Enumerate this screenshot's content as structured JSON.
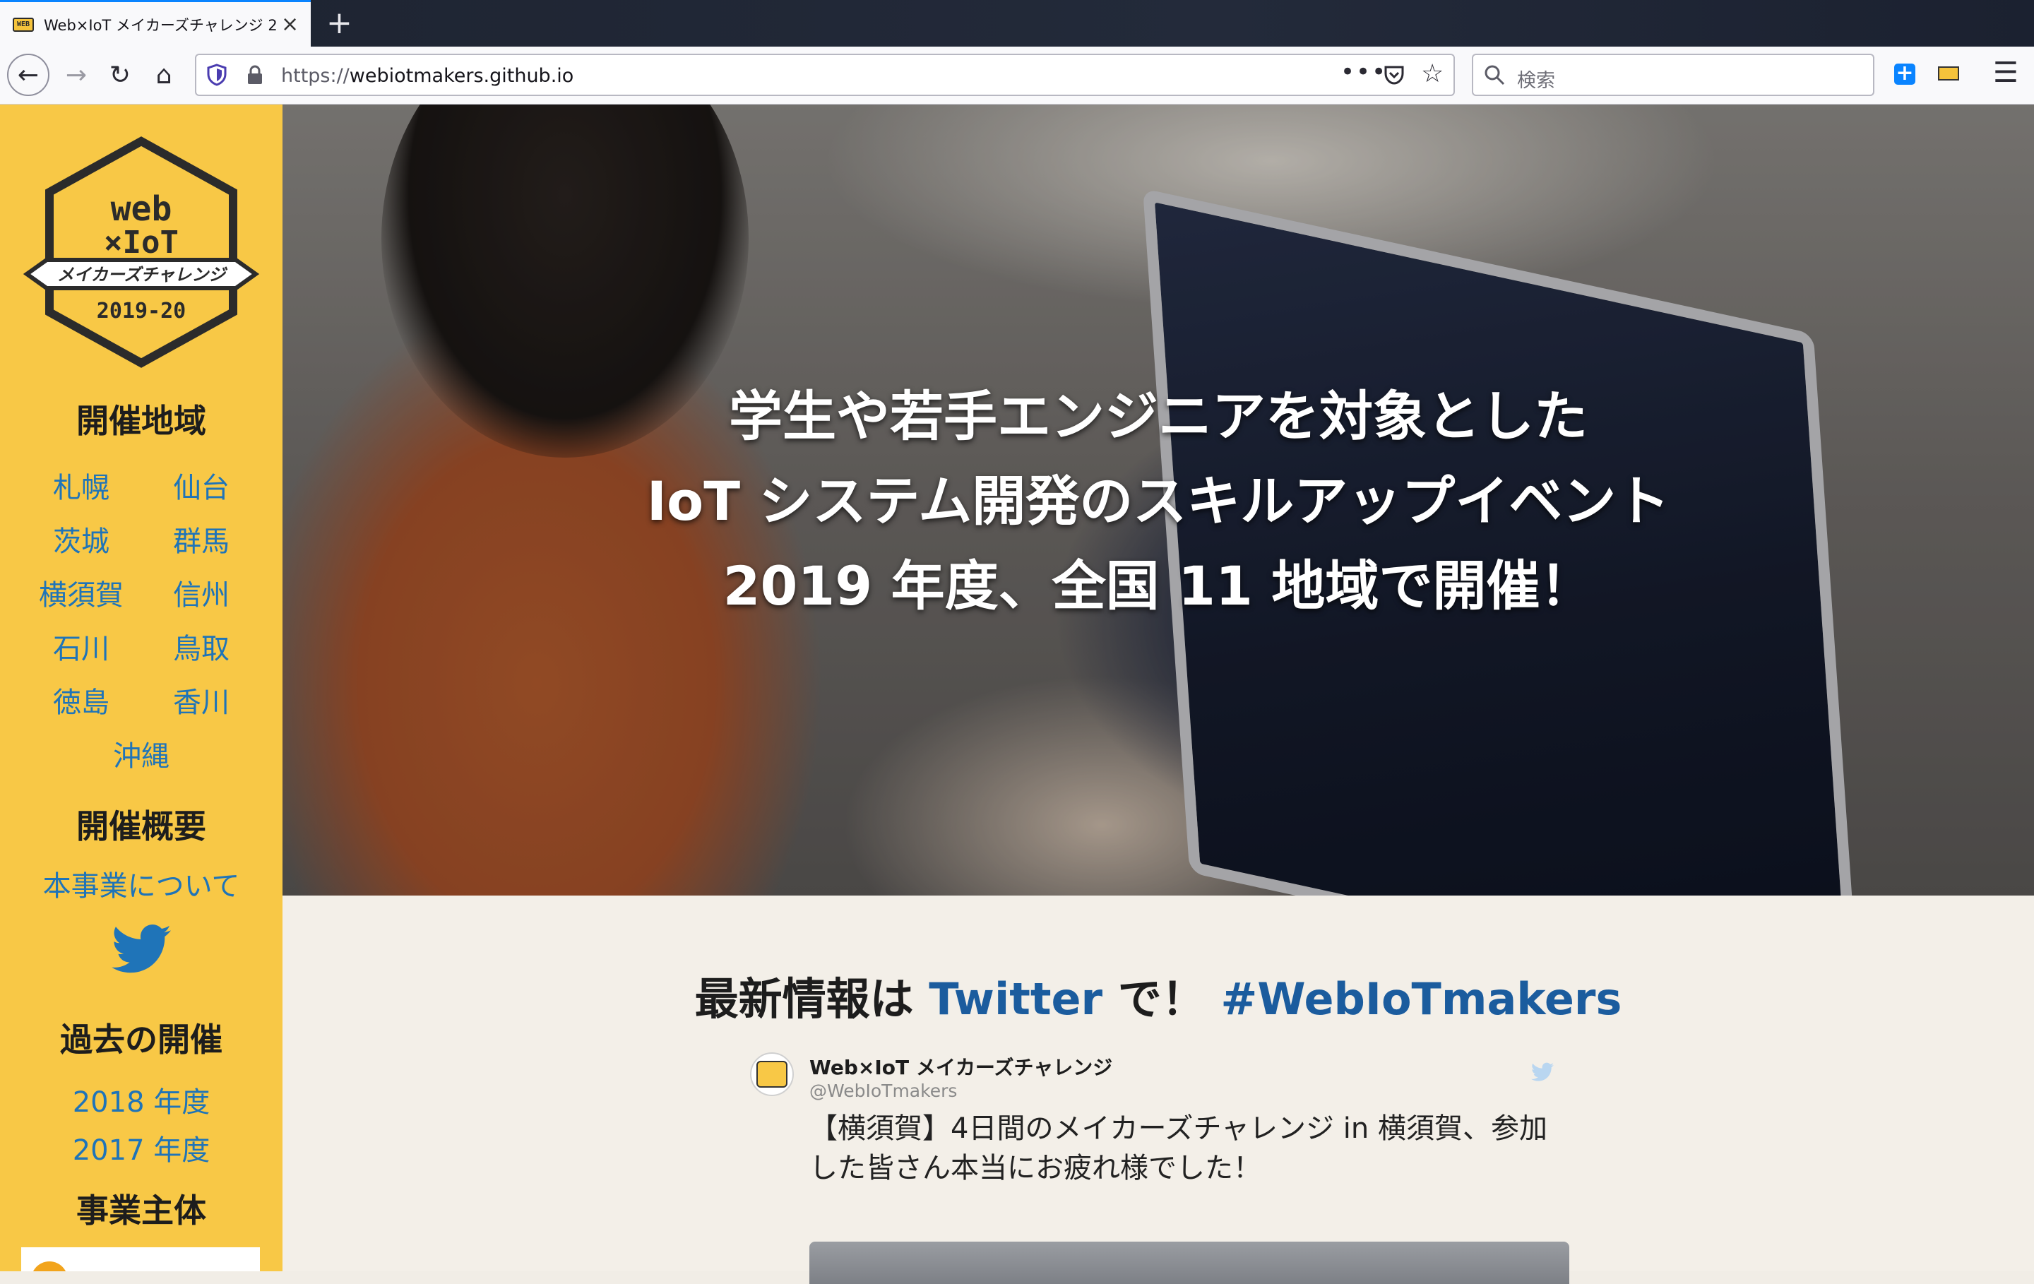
{
  "browser": {
    "tab_title": "Web×IoT メイカーズチャレンジ 2",
    "tab_close": "×",
    "new_tab": "+",
    "favicon_text": "WEB",
    "url_scheme": "https://",
    "url_host": "webiotmakers.github.io",
    "url_more": "•••",
    "search_placeholder": "検索",
    "back_glyph": "←",
    "forward_glyph": "→",
    "reload_glyph": "↻",
    "home_glyph": "⌂",
    "star_glyph": "☆",
    "menu_glyph": "☰",
    "ext_plus": "+"
  },
  "sidebar": {
    "logo": {
      "line1": "web",
      "line2": "×IoT",
      "banner": "メイカーズチャレンジ",
      "year": "2019-20"
    },
    "regions_heading": "開催地域",
    "regions": [
      "札幌",
      "仙台",
      "茨城",
      "群馬",
      "横須賀",
      "信州",
      "石川",
      "鳥取",
      "徳島",
      "香川",
      "沖縄"
    ],
    "overview_heading": "開催概要",
    "about_link": "本事業について",
    "past_heading": "過去の開催",
    "past": [
      "2018 年度",
      "2017 年度"
    ],
    "organizer_heading": "事業主体"
  },
  "hero": {
    "lines": [
      "学生や若手エンジニアを対象とした",
      "IoT システム開発のスキルアップイベント",
      "2019 年度、全国 11 地域で開催！"
    ]
  },
  "latest": {
    "prefix": "最新情報は",
    "twitter": "Twitter",
    "middle": "で！",
    "hashtag": "#WebIoTmakers"
  },
  "tweet": {
    "name": "Web×IoT メイカーズチャレンジ",
    "handle": "@WebIoTmakers",
    "text": "【横須賀】4日間のメイカーズチャレンジ in 横須賀、参加した皆さん本当にお疲れ様でした！"
  },
  "colors": {
    "sidebar_bg": "#f8c846",
    "link_blue": "#1f74b8",
    "accent_blue": "#1b5c9e",
    "page_bg": "#f3efe8"
  }
}
